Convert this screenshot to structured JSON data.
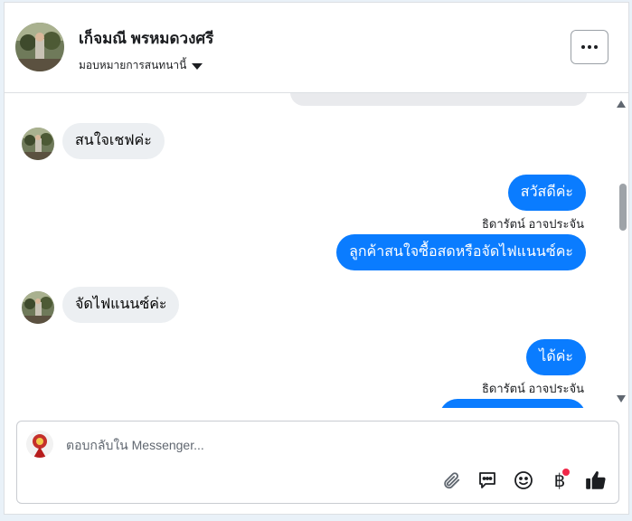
{
  "header": {
    "contact_name": "เก็จมณี พรหมดวงศรี",
    "assign_label": "มอบหมายการสนทนานี้",
    "more_label": "..."
  },
  "messages": [
    {
      "direction": "in",
      "text": "สนใจเชฟค่ะ"
    },
    {
      "direction": "out",
      "text": "สวัสดีค่ะ",
      "sender": "ธิดารัตน์ อาจประจัน"
    },
    {
      "direction": "out",
      "text": "ลูกค้าสนใจซื้อสดหรือจัดไฟแนนซ์คะ"
    },
    {
      "direction": "in",
      "text": "จัดไฟแนนซ์ค่ะ"
    },
    {
      "direction": "out",
      "text": "ได้ค่ะ",
      "sender": "ธิดารัตน์ อาจประจัน"
    }
  ],
  "composer": {
    "placeholder": "ตอบกลับใน Messenger...",
    "baht_symbol": "฿"
  },
  "colors": {
    "outgoing_bubble": "#0a7cff",
    "incoming_bubble": "#eceff2",
    "notification_dot": "#f02849"
  }
}
